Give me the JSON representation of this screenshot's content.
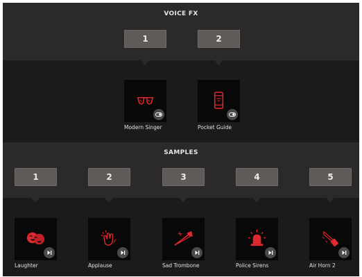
{
  "voice_fx": {
    "title": "VOICE FX",
    "slots": [
      {
        "label": "1"
      },
      {
        "label": "2"
      }
    ],
    "items": [
      {
        "label": "Modern Singer",
        "icon": "sunglasses-icon",
        "badge": "toggle-icon"
      },
      {
        "label": "Pocket Guide",
        "icon": "phone-icon",
        "badge": "toggle-icon"
      }
    ]
  },
  "samples": {
    "title": "SAMPLES",
    "slots": [
      {
        "label": "1"
      },
      {
        "label": "2"
      },
      {
        "label": "3"
      },
      {
        "label": "4"
      },
      {
        "label": "5"
      }
    ],
    "items": [
      {
        "label": "Laughter",
        "icon": "laughing-faces-icon",
        "badge": "play-icon"
      },
      {
        "label": "Applause",
        "icon": "clapping-hands-icon",
        "badge": "play-icon"
      },
      {
        "label": "Sad Trombone",
        "icon": "trombone-icon",
        "badge": "play-icon"
      },
      {
        "label": "Police Sirens",
        "icon": "siren-icon",
        "badge": "play-icon"
      },
      {
        "label": "Air Horn 2",
        "icon": "air-horn-icon",
        "badge": "play-icon"
      }
    ]
  },
  "colors": {
    "background": "#2a2828",
    "tile_band": "#1c1b1b",
    "slot": "#5e5b59",
    "icon_accent": "#e0282f",
    "badge": "#4a4a4a"
  }
}
